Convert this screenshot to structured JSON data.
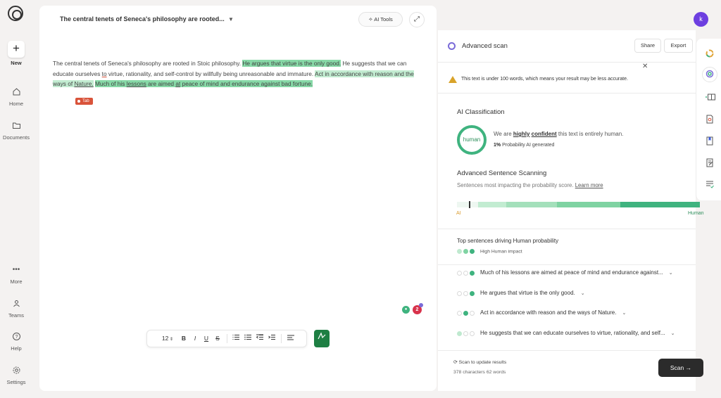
{
  "nav": {
    "new_label": "New",
    "home_label": "Home",
    "documents_label": "Documents",
    "more_label": "More",
    "teams_label": "Teams",
    "help_label": "Help",
    "settings_label": "Settings"
  },
  "editor": {
    "doc_title": "The central tenets of Seneca's philosophy are rooted...",
    "ai_tools_label": "AI Tools",
    "text": {
      "s1": "The central tenets of Seneca's philosophy are rooted in Stoic philosophy. ",
      "s2": "He argues that virtue is the only good.",
      "s3a": " He suggests that we can educate ourselves ",
      "s3b": "to",
      "s3c": " virtue, rationality, and self-control by willfully being unreasonable and immature. ",
      "s4a": "Act in accordance with reason and the ways of ",
      "s4b": "Nature.",
      "s5a": "Much of his ",
      "s5b": "lessons",
      "s5c": " are aimed ",
      "s5d": "at",
      "s5e": " peace of mind and endurance against bad fortune."
    },
    "tab_badge": "Tab",
    "badge_count": "2",
    "toolbar": {
      "font_size": "12",
      "bold": "B",
      "italic": "I",
      "underline": "U",
      "strike": "S"
    }
  },
  "user": {
    "avatar_initial": "k"
  },
  "scan": {
    "title": "Advanced scan",
    "share_label": "Share",
    "export_label": "Export",
    "warning": "This text is under 100 words, which means your result may be less accurate.",
    "ai_classification_title": "AI Classification",
    "ring_label": "human",
    "confidence_prefix": "We are ",
    "confidence_b1": "highly",
    "confidence_b2": "confident",
    "confidence_suffix": " this text is entirely human.",
    "prob_value": "1%",
    "prob_label": " Probability AI generated",
    "adv_title": "Advanced Sentence Scanning",
    "adv_sub": "Sentences most impacting the probability score. ",
    "learn_more": "Learn more",
    "bar_ai_label": "AI",
    "bar_human_label": "Human",
    "top_title": "Top sentences driving Human probability",
    "impact_label": "High Human impact",
    "sentences": [
      {
        "text": "Much of his lessons are aimed at peace of mind and endurance against...",
        "impact": 3
      },
      {
        "text": "He argues that virtue is the only good.",
        "impact": 3
      },
      {
        "text": "Act in accordance with reason and the ways of Nature.",
        "impact": 2
      },
      {
        "text": "He suggests that we can educate ourselves to virtue, rationality, and self...",
        "impact": 1
      }
    ],
    "update_label": "Scan to update results",
    "counts": "378 characters 62 words",
    "scan_btn": "Scan"
  },
  "colors": {
    "accent_green": "#3fb37f",
    "highlight_strong": "#87d9a7",
    "highlight_light": "#c2ecd1",
    "tab_badge": "#d9533a",
    "ai_label": "#d99a2b",
    "avatar": "#6d3fe0",
    "scan_button": "#2b2b2b"
  }
}
